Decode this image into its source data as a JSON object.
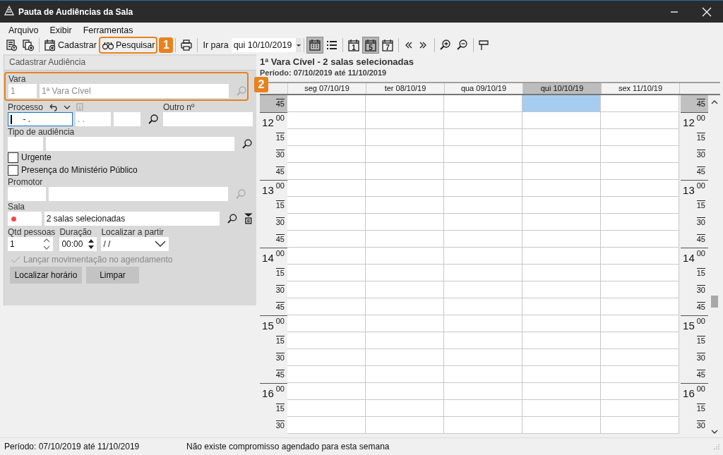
{
  "window": {
    "title": "Pauta de Audiências da Sala"
  },
  "menu": [
    "Arquivo",
    "Exibir",
    "Ferramentas"
  ],
  "toolbar": [
    {
      "kind": "button"
    },
    {
      "kind": "button"
    },
    {
      "kind": "sep"
    },
    {
      "kind": "button",
      "label": "Cadastrar"
    },
    {
      "kind": "button",
      "label": "Pesquisar",
      "callout": "1"
    },
    {
      "kind": "sep"
    },
    {
      "kind": "button"
    },
    {
      "kind": "sep"
    },
    {
      "kind": "label",
      "label": "Ir para"
    },
    {
      "kind": "combo",
      "value": "qui 10/10/2019"
    },
    {
      "kind": "sep"
    },
    {
      "kind": "toggle",
      "selected": true
    },
    {
      "kind": "toggle",
      "selected": false
    },
    {
      "kind": "sep"
    },
    {
      "kind": "toggle",
      "text": "1",
      "selected": false
    },
    {
      "kind": "toggle",
      "text": "5",
      "selected": true
    },
    {
      "kind": "toggle",
      "text": "7",
      "selected": false
    },
    {
      "kind": "sep"
    },
    {
      "kind": "button"
    },
    {
      "kind": "button"
    },
    {
      "kind": "sep"
    },
    {
      "kind": "button"
    },
    {
      "kind": "button"
    },
    {
      "kind": "sep"
    },
    {
      "kind": "button"
    }
  ],
  "form": {
    "title": "Cadastrar Audiência",
    "vara": {
      "label": "Vara",
      "code": "1",
      "name": "1ª Vara Cível",
      "disabled": true,
      "callout": "2"
    },
    "processo": {
      "label": "Processo",
      "mask1": "-  .",
      "mask2": ". .",
      "focused": true
    },
    "outro": {
      "label": "Outro nº"
    },
    "tipo": {
      "label": "Tipo de audiência"
    },
    "checkboxes": [
      {
        "label": "Urgente",
        "checked": false
      },
      {
        "label": "Presença do Ministério Público",
        "checked": false
      }
    ],
    "promotor": {
      "label": "Promotor",
      "disabled": true
    },
    "sala": {
      "label": "Sala",
      "color": "#f04a4a",
      "value": "2 salas selecionadas"
    },
    "qtd": {
      "label": "Qtd pessoas",
      "value": "1"
    },
    "duracao": {
      "label": "Duração",
      "value": "00:00"
    },
    "localizar": {
      "label": "Localizar a partir",
      "value": "/ /"
    },
    "lancar": {
      "label": "Lançar movimentação no agendamento",
      "checked": true,
      "disabled": true
    },
    "buttons": [
      "Localizar horário",
      "Limpar"
    ]
  },
  "calendar": {
    "title": "1ª Vara Cível - 2 salas selecionadas",
    "period": "Período: 07/10/2019 até 11/10/2019",
    "days": [
      {
        "label": "seg 07/10/19",
        "selected": false
      },
      {
        "label": "ter 08/10/19",
        "selected": false
      },
      {
        "label": "qua 09/10/19",
        "selected": false
      },
      {
        "label": "qui 10/10/19",
        "selected": true
      },
      {
        "label": "sex 11/10/19",
        "selected": false
      }
    ],
    "gutters": [
      {
        "slots": [
          {
            "minute": "45",
            "selected": true
          },
          {
            "hour": "12",
            "minute": "00",
            "selected": false
          },
          {
            "minute": "15",
            "selected": false
          },
          {
            "minute": "30",
            "selected": false
          },
          {
            "minute": "45",
            "selected": false
          },
          {
            "hour": "13",
            "minute": "00",
            "selected": false
          },
          {
            "minute": "15",
            "selected": false
          },
          {
            "minute": "30",
            "selected": false
          },
          {
            "minute": "45",
            "selected": false
          },
          {
            "hour": "14",
            "minute": "00",
            "selected": false
          },
          {
            "minute": "15",
            "selected": false
          },
          {
            "minute": "30",
            "selected": false
          },
          {
            "minute": "45",
            "selected": false
          },
          {
            "hour": "15",
            "minute": "00",
            "selected": false
          },
          {
            "minute": "15",
            "selected": false
          },
          {
            "minute": "30",
            "selected": false
          },
          {
            "minute": "45",
            "selected": false
          },
          {
            "hour": "16",
            "minute": "00",
            "selected": false
          },
          {
            "minute": "15",
            "selected": false
          },
          {
            "minute": "30",
            "selected": false
          }
        ]
      },
      {
        "slots": [
          {
            "minute": "45",
            "selected": true
          },
          {
            "hour": "12",
            "minute": "00",
            "selected": false
          },
          {
            "minute": "15",
            "selected": false
          },
          {
            "minute": "30",
            "selected": false
          },
          {
            "minute": "45",
            "selected": false
          },
          {
            "hour": "13",
            "minute": "00",
            "selected": false
          },
          {
            "minute": "15",
            "selected": false
          },
          {
            "minute": "30",
            "selected": false
          },
          {
            "minute": "45",
            "selected": false
          },
          {
            "hour": "14",
            "minute": "00",
            "selected": false
          },
          {
            "minute": "15",
            "selected": false
          },
          {
            "minute": "30",
            "selected": false
          },
          {
            "minute": "45",
            "selected": false
          },
          {
            "hour": "15",
            "minute": "00",
            "selected": false
          },
          {
            "minute": "15",
            "selected": false
          },
          {
            "minute": "30",
            "selected": false
          },
          {
            "minute": "45",
            "selected": false
          },
          {
            "hour": "16",
            "minute": "00",
            "selected": false
          },
          {
            "minute": "15",
            "selected": false
          },
          {
            "minute": "30",
            "selected": false
          }
        ]
      }
    ]
  },
  "status_bar": [
    "Período: 07/10/2019 até 11/10/2019",
    "Não existe compromisso agendado para esta semana"
  ]
}
